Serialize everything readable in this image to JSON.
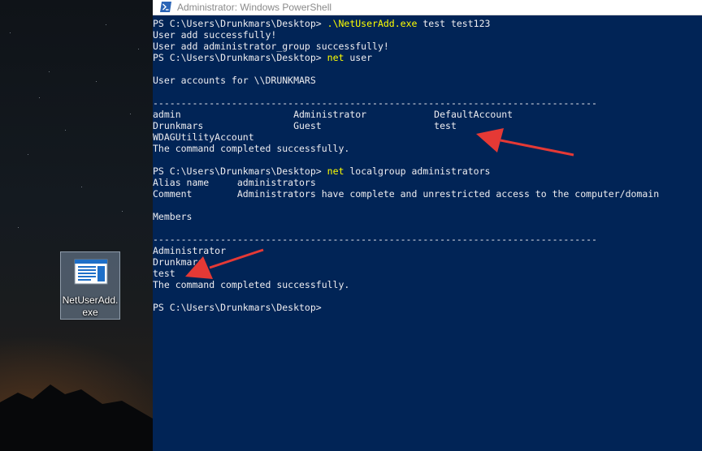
{
  "desktop": {
    "icon": {
      "name": "file-icon",
      "label": "NetUserAdd.exe"
    }
  },
  "window": {
    "title": "Administrator: Windows PowerShell",
    "icon": "powershell-icon",
    "background": "#012456",
    "text_color": "#eeedf0",
    "command_color": "#ffff00",
    "annotation_arrow_color": "#e53935"
  },
  "console": {
    "lines": [
      {
        "prompt": "PS C:\\Users\\Drunkmars\\Desktop> ",
        "command": ".\\NetUserAdd.exe",
        "args": " test test123"
      },
      {
        "text": "User add successfully!"
      },
      {
        "text": "User add administrator_group successfully!"
      },
      {
        "prompt": "PS C:\\Users\\Drunkmars\\Desktop> ",
        "command": "net",
        "args": " user"
      },
      {
        "text": ""
      },
      {
        "text": "User accounts for \\\\DRUNKMARS"
      },
      {
        "text": ""
      },
      {
        "text": "-------------------------------------------------------------------------------"
      },
      {
        "text": "admin                    Administrator            DefaultAccount"
      },
      {
        "text": "Drunkmars                Guest                    test"
      },
      {
        "text": "WDAGUtilityAccount"
      },
      {
        "text": "The command completed successfully."
      },
      {
        "text": ""
      },
      {
        "prompt": "PS C:\\Users\\Drunkmars\\Desktop> ",
        "command": "net",
        "args": " localgroup administrators"
      },
      {
        "text": "Alias name     administrators"
      },
      {
        "text": "Comment        Administrators have complete and unrestricted access to the computer/domain"
      },
      {
        "text": ""
      },
      {
        "text": "Members"
      },
      {
        "text": ""
      },
      {
        "text": "-------------------------------------------------------------------------------"
      },
      {
        "text": "Administrator"
      },
      {
        "text": "Drunkmars"
      },
      {
        "text": "test"
      },
      {
        "text": "The command completed successfully."
      },
      {
        "text": ""
      },
      {
        "prompt": "PS C:\\Users\\Drunkmars\\Desktop>",
        "command": "",
        "args": ""
      }
    ]
  }
}
